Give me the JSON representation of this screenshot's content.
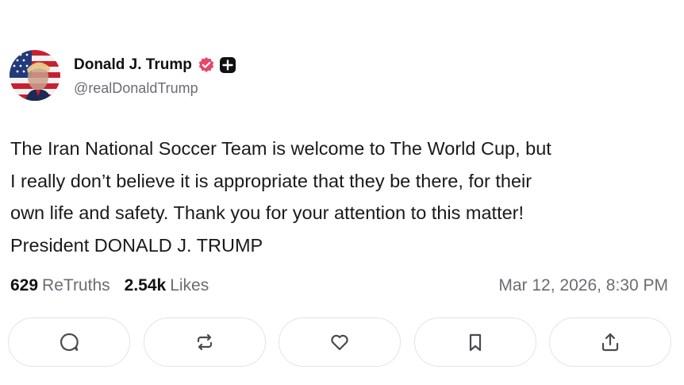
{
  "author": {
    "display_name": "Donald J. Trump",
    "handle": "@realDonaldTrump",
    "avatar_icon": "avatar-flag-portrait",
    "verified_icon": "verified-badge-icon",
    "verified_color": "#e8466a",
    "plus_icon": "plus-badge-icon"
  },
  "post": {
    "lines": [
      "The Iran National Soccer Team is welcome to The World Cup, but",
      "I really don’t believe it is appropriate that they be there, for their",
      "own life and safety. Thank you for your attention to this matter!",
      "President DONALD J. TRUMP"
    ]
  },
  "stats": {
    "retruths_count": "629",
    "retruths_label": "ReTruths",
    "likes_count": "2.54k",
    "likes_label": "Likes",
    "timestamp": "Mar 12, 2026, 8:30 PM"
  },
  "actions": [
    {
      "icon": "reply-icon"
    },
    {
      "icon": "retruth-icon"
    },
    {
      "icon": "like-icon"
    },
    {
      "icon": "bookmark-icon"
    },
    {
      "icon": "share-icon"
    }
  ]
}
